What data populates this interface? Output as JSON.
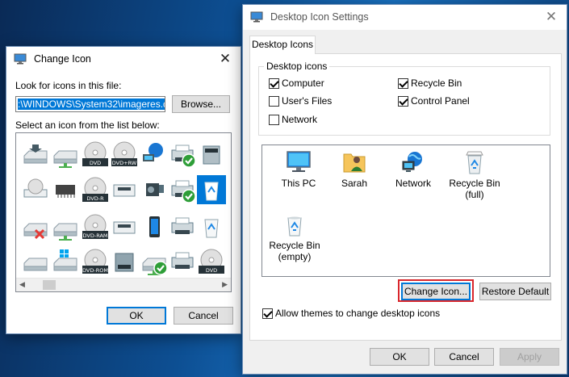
{
  "change_icon": {
    "title": "Change Icon",
    "close_glyph": "✕",
    "look_label": "Look for icons in this file:",
    "file_path": ":\\WINDOWS\\System32\\imageres.dll",
    "browse_label": "Browse...",
    "select_label": "Select an icon from the list below:",
    "ok_label": "OK",
    "cancel_label": "Cancel",
    "icon_grid": [
      [
        "drive-with-arrow-icon",
        "network-drive-icon",
        "dvd-drive-icon",
        "dvd-rw-disc-icon",
        "network-globe-icon",
        "printer-check-icon",
        "scanner-drive-icon"
      ],
      [
        "cd-drive-icon",
        "chip-icon",
        "dvd-r-disc-icon",
        "floppy-drive-icon",
        "camcorder-icon",
        "printer-check-icon",
        "recycle-bin-selected-icon"
      ],
      [
        "drive-error-icon",
        "network-drive-icon",
        "dvd-ram-disc-icon",
        "removable-drive-icon",
        "phone-icon",
        "printer-icon",
        "recycle-bin-icon"
      ],
      [
        "drive-icon",
        "windows-drive-icon",
        "dvd-rom-disc-icon",
        "tape-drive-icon",
        "network-check-icon",
        "printer-icon",
        "dvd-disc-icon"
      ]
    ],
    "disc_labels": {
      "dvd": "DVD",
      "dvdrw": "DVD+RW",
      "dvdr": "DVD-R",
      "dvdram": "DVD-RAM",
      "dvdrom": "DVD-ROM"
    }
  },
  "desktop_icon_settings": {
    "title": "Desktop Icon Settings",
    "close_glyph": "✕",
    "tab_label": "Desktop Icons",
    "group_label": "Desktop icons",
    "checkboxes": [
      {
        "label": "Computer",
        "checked": true
      },
      {
        "label": "Recycle Bin",
        "checked": true
      },
      {
        "label": "User's Files",
        "checked": false
      },
      {
        "label": "Control Panel",
        "checked": true
      },
      {
        "label": "Network",
        "checked": false
      }
    ],
    "preview_icons": [
      {
        "name": "this-pc-icon",
        "label": "This PC"
      },
      {
        "name": "user-folder-icon",
        "label": "Sarah"
      },
      {
        "name": "network-icon",
        "label": "Network"
      },
      {
        "name": "recycle-bin-full-icon",
        "label": "Recycle Bin\n(full)"
      },
      {
        "name": "recycle-bin-empty-icon",
        "label": "Recycle Bin\n(empty)"
      }
    ],
    "change_icon_label": "Change Icon...",
    "restore_default_label": "Restore Default",
    "allow_themes_label": "Allow themes to change desktop icons",
    "allow_themes_checked": true,
    "ok_label": "OK",
    "cancel_label": "Cancel",
    "apply_label": "Apply",
    "highlight_color": "#d9262c",
    "accent_color": "#0078d7"
  }
}
